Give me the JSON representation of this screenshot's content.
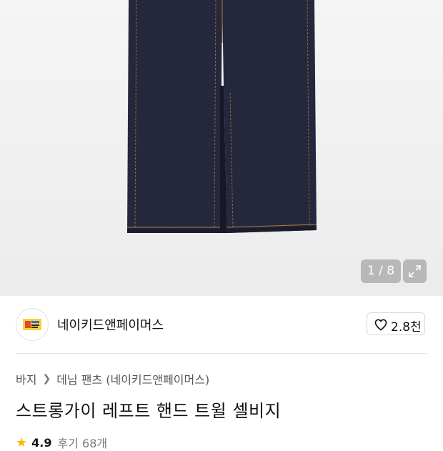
{
  "gallery": {
    "counter": "1 / 8",
    "image_alt": "dark indigo denim jeans"
  },
  "brand": {
    "name": "네이키드앤페이머스",
    "likes": "2.8천"
  },
  "breadcrumb": {
    "category": "바지",
    "subcategory": "데님 팬츠 (네이키드앤페이머스)"
  },
  "product": {
    "title": "스트롱가이 레프트 핸드 트윌 셀비지"
  },
  "rating": {
    "score": "4.9",
    "reviews": "후기 68개"
  },
  "colors": {
    "denim": "#23253a",
    "stitch": "#b07a3a",
    "star": "#ffb400"
  }
}
